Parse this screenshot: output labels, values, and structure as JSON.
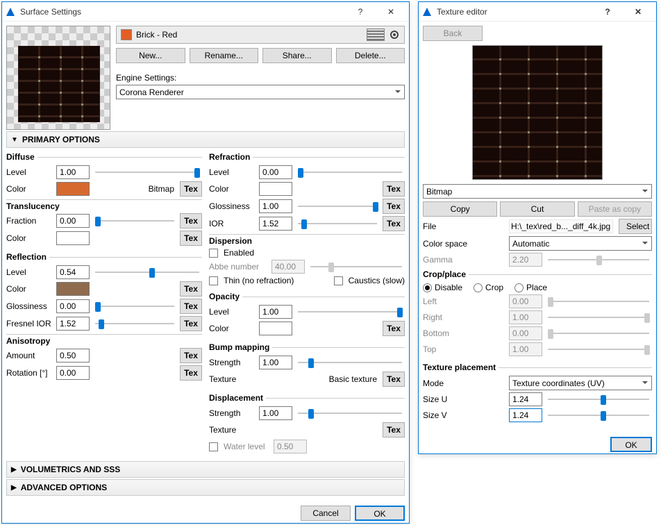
{
  "win1": {
    "title": "Surface Settings",
    "material_name": "Brick - Red",
    "btns": {
      "new": "New...",
      "rename": "Rename...",
      "share": "Share...",
      "delete": "Delete..."
    },
    "engine_label": "Engine Settings:",
    "engine_value": "Corona Renderer",
    "sec1": "PRIMARY OPTIONS",
    "sec2": "VOLUMETRICS AND SSS",
    "sec3": "ADVANCED OPTIONS",
    "diffuse": {
      "legend": "Diffuse",
      "level_l": "Level",
      "level": "1.00",
      "color_l": "Color",
      "bitmap": "Bitmap",
      "tex": "Tex",
      "trans_l": "Translucency",
      "frac_l": "Fraction",
      "frac": "0.00",
      "color2_l": "Color"
    },
    "reflection": {
      "legend": "Reflection",
      "level_l": "Level",
      "level": "0.54",
      "color_l": "Color",
      "gloss_l": "Glossiness",
      "gloss": "0.00",
      "ior_l": "Fresnel IOR",
      "ior": "1.52",
      "aniso_l": "Anisotropy",
      "amt_l": "Amount",
      "amt": "0.50",
      "rot_l": "Rotation [°]",
      "rot": "0.00"
    },
    "refraction": {
      "legend": "Refraction",
      "level_l": "Level",
      "level": "0.00",
      "color_l": "Color",
      "gloss_l": "Glossiness",
      "gloss": "1.00",
      "ior_l": "IOR",
      "ior": "1.52",
      "disp_l": "Dispersion",
      "enabled": "Enabled",
      "abbe_l": "Abbe number",
      "abbe": "40.00",
      "thin": "Thin (no refraction)",
      "caustics": "Caustics (slow)"
    },
    "opacity": {
      "legend": "Opacity",
      "level_l": "Level",
      "level": "1.00",
      "color_l": "Color"
    },
    "bump": {
      "legend": "Bump mapping",
      "str_l": "Strength",
      "str": "1.00",
      "tex_l": "Texture",
      "basic": "Basic texture"
    },
    "disp": {
      "legend": "Displacement",
      "str_l": "Strength",
      "str": "1.00",
      "tex_l": "Texture",
      "water": "Water level",
      "water_v": "0.50"
    },
    "ok": "OK",
    "cancel": "Cancel"
  },
  "win2": {
    "title": "Texture editor",
    "back": "Back",
    "type": "Bitmap",
    "copy": "Copy",
    "cut": "Cut",
    "paste": "Paste as copy",
    "file_l": "File",
    "file": "H:\\_tex\\red_b..._diff_4k.jpg",
    "select": "Select",
    "cs_l": "Color space",
    "cs": "Automatic",
    "gamma_l": "Gamma",
    "gamma": "2.20",
    "crop": {
      "legend": "Crop/place",
      "disable": "Disable",
      "crop": "Crop",
      "place": "Place",
      "left_l": "Left",
      "left": "0.00",
      "right_l": "Right",
      "right": "1.00",
      "bottom_l": "Bottom",
      "bottom": "0.00",
      "top_l": "Top",
      "top": "1.00"
    },
    "tp": {
      "legend": "Texture placement",
      "mode_l": "Mode",
      "mode": "Texture coordinates (UV)",
      "su_l": "Size U",
      "su": "1.24",
      "sv_l": "Size V",
      "sv": "1.24"
    },
    "ok": "OK"
  }
}
